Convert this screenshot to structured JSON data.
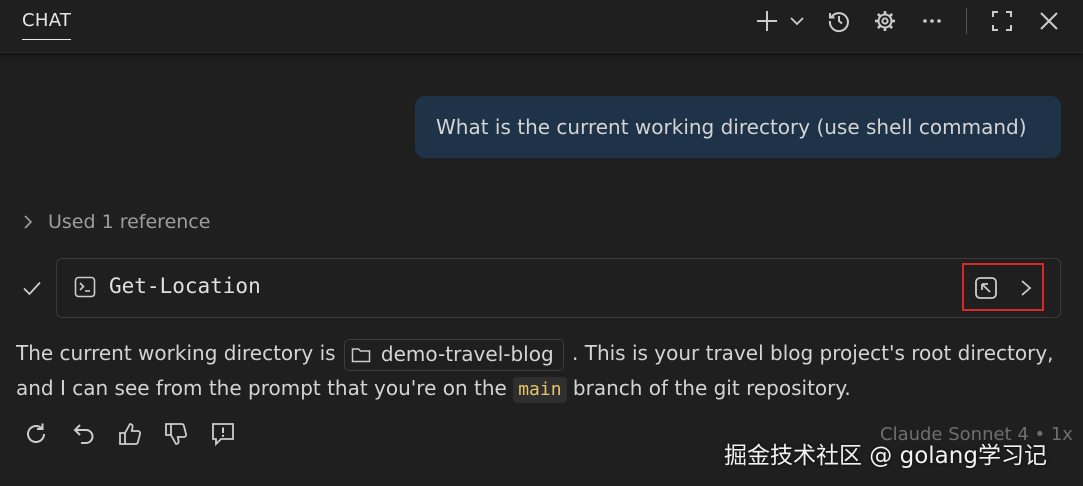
{
  "header": {
    "tab_label": "CHAT"
  },
  "messages": {
    "user": {
      "text": "What is the current working directory (use shell command)"
    },
    "references": {
      "label": "Used 1 reference"
    },
    "tool_call": {
      "name": "Get-Location"
    },
    "response": {
      "part1": "The current working directory is ",
      "folder": "demo-travel-blog",
      "part2": ". This is your travel blog project's root directory, and I can see from the prompt that you're on the ",
      "branch": "main",
      "part3": " branch of the git repository."
    }
  },
  "footer": {
    "model": "Claude Sonnet 4 • 1x"
  },
  "watermark": "掘金技术社区 @ golang学习记",
  "colors": {
    "background": "#1f1f1f",
    "user_bubble": "#1e3248",
    "highlight_border": "#d42a2a",
    "code_text": "#e9c46a"
  },
  "icons": [
    "plus-icon",
    "chevron-down-icon",
    "history-icon",
    "gear-icon",
    "more-icon",
    "maximize-icon",
    "close-icon",
    "chevron-right-icon",
    "check-icon",
    "terminal-icon",
    "open-in-terminal-icon",
    "folder-icon",
    "retry-icon",
    "undo-icon",
    "thumbs-up-icon",
    "thumbs-down-icon",
    "report-icon"
  ]
}
